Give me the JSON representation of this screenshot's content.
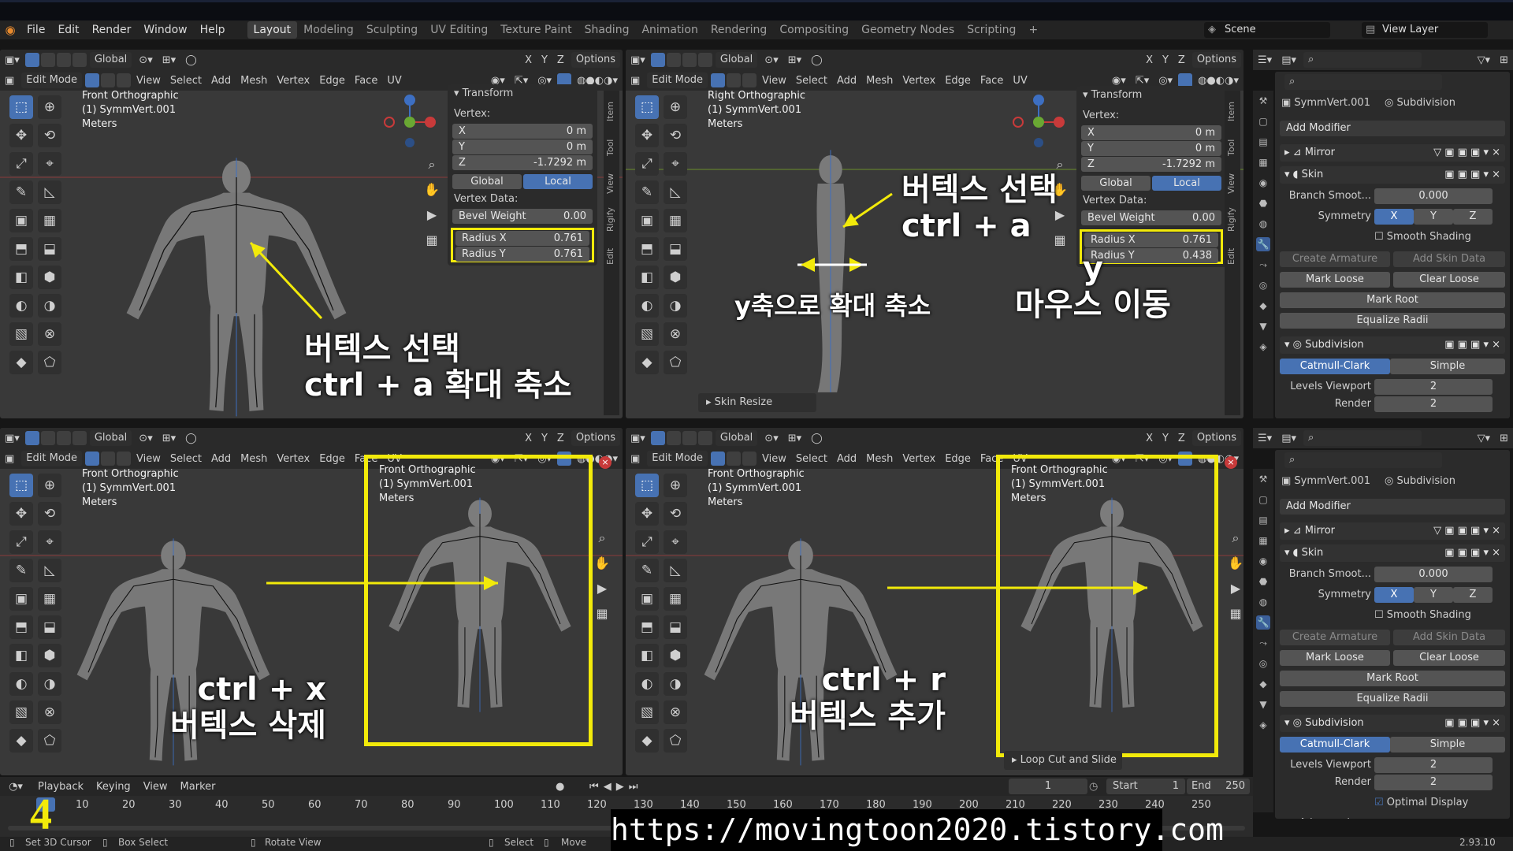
{
  "menu": {
    "items": [
      "File",
      "Edit",
      "Render",
      "Window",
      "Help"
    ],
    "workspaces": [
      "Layout",
      "Modeling",
      "Sculpting",
      "UV Editing",
      "Texture Paint",
      "Shading",
      "Animation",
      "Rendering",
      "Compositing",
      "Geometry Nodes",
      "Scripting"
    ],
    "active_workspace": "Layout",
    "add_tab": "+",
    "scene": "Scene",
    "view_layer": "View Layer"
  },
  "viewport_header": {
    "orientation": "Global",
    "options": "Options",
    "mode": "Edit Mode",
    "menus": [
      "View",
      "Select",
      "Add",
      "Mesh",
      "Vertex",
      "Edge",
      "Face",
      "UV"
    ],
    "axes": [
      "X",
      "Y",
      "Z"
    ]
  },
  "viewports": [
    {
      "view": "Front Orthographic",
      "object": "(1) SymmVert.001",
      "units": "Meters"
    },
    {
      "view": "Right Orthographic",
      "object": "(1) SymmVert.001",
      "units": "Meters"
    },
    {
      "view": "Front Orthographic",
      "object": "(1) SymmVert.001",
      "units": "Meters"
    },
    {
      "view": "Front Orthographic",
      "object": "(1) SymmVert.001",
      "units": "Meters"
    }
  ],
  "inset_labels": [
    {
      "view": "Front Orthographic",
      "object": "(1) SymmVert.001",
      "units": "Meters"
    },
    {
      "view": "Front Orthographic",
      "object": "(1) SymmVert.001",
      "units": "Meters"
    }
  ],
  "transform_panels": [
    {
      "title": "Transform",
      "vertex_label": "Vertex:",
      "x_label": "X",
      "x": "0 m",
      "y_label": "Y",
      "y": "0 m",
      "z_label": "Z",
      "z": "-1.7292 m",
      "global": "Global",
      "local": "Local",
      "vertex_data": "Vertex Data:",
      "bevel_label": "Bevel Weight",
      "bevel": "0.00",
      "radius_x_label": "Radius X",
      "radius_x": "0.761",
      "radius_y_label": "Radius Y",
      "radius_y": "0.761"
    },
    {
      "title": "Transform",
      "vertex_label": "Vertex:",
      "x_label": "X",
      "x": "0 m",
      "y_label": "Y",
      "y": "0 m",
      "z_label": "Z",
      "z": "-1.7292 m",
      "global": "Global",
      "local": "Local",
      "vertex_data": "Vertex Data:",
      "bevel_label": "Bevel Weight",
      "bevel": "0.00",
      "radius_x_label": "Radius X",
      "radius_x": "0.761",
      "radius_y_label": "Radius Y",
      "radius_y": "0.438"
    }
  ],
  "side_tabs": [
    "Item",
    "Tool",
    "View",
    "Rigify",
    "Edit"
  ],
  "properties": [
    {
      "object": "SymmVert.001",
      "modifier_context": "Subdivision",
      "add_modifier": "Add Modifier",
      "mirror": "Mirror",
      "skin": "Skin",
      "branch_label": "Branch Smoot...",
      "branch": "0.000",
      "symmetry_label": "Symmetry",
      "sym_x": "X",
      "sym_y": "Y",
      "sym_z": "Z",
      "smooth_shading": "Smooth Shading",
      "create_armature": "Create Armature",
      "add_skin_data": "Add Skin Data",
      "mark_loose": "Mark Loose",
      "clear_loose": "Clear Loose",
      "mark_root": "Mark Root",
      "equalize_radii": "Equalize Radii",
      "subdivision": "Subdivision",
      "catmull": "Catmull-Clark",
      "simple": "Simple",
      "levels_label": "Levels Viewport",
      "levels": "2",
      "render_label": "Render",
      "render": "2"
    },
    {
      "object": "SymmVert.001",
      "modifier_context": "Subdivision",
      "add_modifier": "Add Modifier",
      "mirror": "Mirror",
      "skin": "Skin",
      "branch_label": "Branch Smoot...",
      "branch": "0.000",
      "symmetry_label": "Symmetry",
      "sym_x": "X",
      "sym_y": "Y",
      "sym_z": "Z",
      "smooth_shading": "Smooth Shading",
      "create_armature": "Create Armature",
      "add_skin_data": "Add Skin Data",
      "mark_loose": "Mark Loose",
      "clear_loose": "Clear Loose",
      "mark_root": "Mark Root",
      "equalize_radii": "Equalize Radii",
      "subdivision": "Subdivision",
      "catmull": "Catmull-Clark",
      "simple": "Simple",
      "levels_label": "Levels Viewport",
      "levels": "2",
      "render_label": "Render",
      "render": "2",
      "optimal_display": "Optimal Display",
      "advanced": "Advanced"
    }
  ],
  "operator_panels": {
    "skin_resize": "Skin Resize",
    "loop_cut": "Loop Cut and Slide"
  },
  "annotations": {
    "tl": "버텍스 선택\nctrl + a 확대 축소",
    "tr1": "버텍스 선택\nctrl + a",
    "tr2": "y\n마우스 이동",
    "tr3": "y축으로 확대 축소",
    "bl": "ctrl + x\n버텍스 삭제",
    "br": "ctrl + r\n버텍스 추가"
  },
  "timeline": {
    "menus": [
      "Playback",
      "Keying",
      "View",
      "Marker"
    ],
    "current_frame": "1",
    "start_label": "Start",
    "start": "1",
    "end_label": "End",
    "end": "250",
    "ticks": [
      "10",
      "20",
      "30",
      "40",
      "50",
      "60",
      "70",
      "80",
      "90",
      "100",
      "110",
      "120",
      "130",
      "140",
      "150",
      "160",
      "170",
      "180",
      "190",
      "200",
      "210",
      "220",
      "230",
      "240",
      "250"
    ]
  },
  "status": {
    "set_cursor": "Set 3D Cursor",
    "box_select": "Box Select",
    "rotate_view": "Rotate View",
    "select": "Select",
    "move": "Move",
    "version": "2.93.10"
  },
  "overlay": {
    "url": "https://movingtoon2020.tistory.com",
    "number": "4"
  },
  "colors": {
    "accent": "#4772b3",
    "highlight": "#f2ea0a",
    "bg": "#393939",
    "orange": "#e88a2d"
  }
}
